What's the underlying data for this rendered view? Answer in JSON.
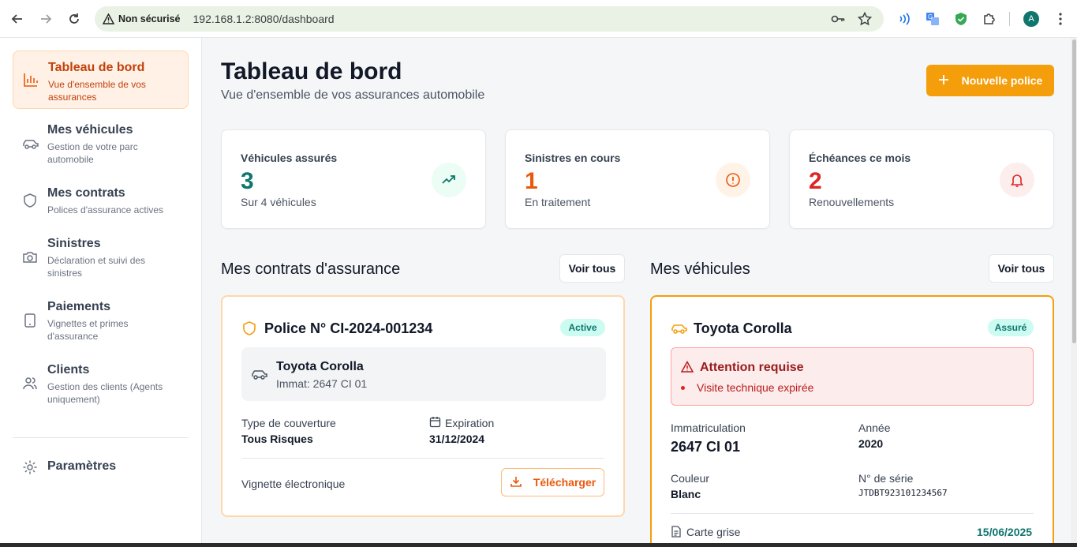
{
  "browser": {
    "security_label": "Non sécurisé",
    "url": "192.168.1.2:8080/dashboard",
    "profile_initial": "A"
  },
  "sidebar": {
    "items": [
      {
        "title": "Tableau de bord",
        "desc": "Vue d'ensemble de vos assurances",
        "icon": "bar-chart-icon",
        "active": true
      },
      {
        "title": "Mes véhicules",
        "desc": "Gestion de votre parc automobile",
        "icon": "car-icon"
      },
      {
        "title": "Mes contrats",
        "desc": "Polices d'assurance actives",
        "icon": "shield-icon"
      },
      {
        "title": "Sinistres",
        "desc": "Déclaration et suivi des sinistres",
        "icon": "camera-icon"
      },
      {
        "title": "Paiements",
        "desc": "Vignettes et primes d'assurance",
        "icon": "phone-icon"
      },
      {
        "title": "Clients",
        "desc": "Gestion des clients (Agents uniquement)",
        "icon": "users-icon"
      }
    ],
    "settings_label": "Paramètres"
  },
  "header": {
    "title": "Tableau de bord",
    "subtitle": "Vue d'ensemble de vos assurances automobile",
    "new_policy_label": "Nouvelle police"
  },
  "stats": [
    {
      "label": "Véhicules assurés",
      "value": "3",
      "sub": "Sur 4 véhicules",
      "color": "#0f766e",
      "icon": "trending-up-icon"
    },
    {
      "label": "Sinistres en cours",
      "value": "1",
      "sub": "En traitement",
      "color": "#ea580c",
      "icon": "alert-circle-icon"
    },
    {
      "label": "Échéances ce mois",
      "value": "2",
      "sub": "Renouvellements",
      "color": "#dc2626",
      "icon": "bell-icon"
    }
  ],
  "contracts": {
    "section_title": "Mes contrats d'assurance",
    "see_all_label": "Voir tous",
    "card": {
      "title": "Police N° CI-2024-001234",
      "status": "Active",
      "vehicle_name": "Toyota Corolla",
      "vehicle_plate": "Immat: 2647 CI 01",
      "coverage_label": "Type de couverture",
      "coverage_value": "Tous Risques",
      "expiration_label": "Expiration",
      "expiration_value": "31/12/2024",
      "vignette_label": "Vignette électronique",
      "download_label": "Télécharger"
    }
  },
  "vehicles": {
    "section_title": "Mes véhicules",
    "see_all_label": "Voir tous",
    "card": {
      "title": "Toyota Corolla",
      "status": "Assuré",
      "alert_title": "Attention requise",
      "alert_item": "Visite technique expirée",
      "plate_label": "Immatriculation",
      "plate_value": "2647 CI 01",
      "year_label": "Année",
      "year_value": "2020",
      "color_label": "Couleur",
      "color_value": "Blanc",
      "serial_label": "N° de série",
      "serial_value": "JTDBT923101234567",
      "registration_label": "Carte grise",
      "registration_date": "15/06/2025"
    }
  }
}
